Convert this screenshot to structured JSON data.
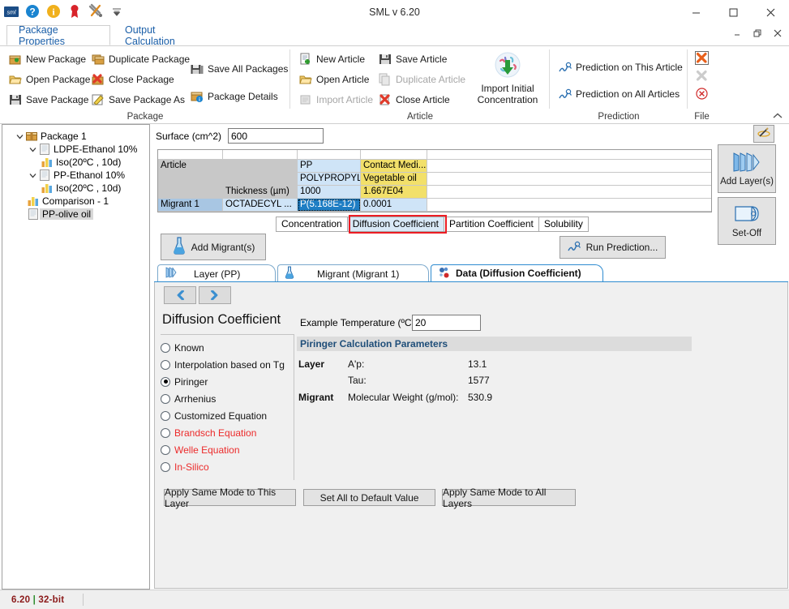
{
  "window": {
    "title": "SML v 6.20",
    "minimize": "—",
    "maximize": "☐",
    "close": "✕",
    "sub_minimize": "–",
    "sub_restore": "❐",
    "sub_close": "✕"
  },
  "quick_access": {
    "icons": [
      "sml-logo-icon",
      "help-icon",
      "info-icon",
      "award-icon",
      "tools-icon",
      "customize-qat-icon"
    ]
  },
  "ribbon_tabs": [
    {
      "label": "Package Properties",
      "active": true
    },
    {
      "label": "Output Calculation",
      "active": false
    }
  ],
  "ribbon": {
    "collapse_label": "˄",
    "groups": [
      {
        "name": "Package",
        "label": "Package",
        "items": [
          {
            "label": "New Package",
            "icon": "new-package-icon",
            "disabled": false
          },
          {
            "label": "Open Package",
            "icon": "open-package-icon",
            "disabled": false
          },
          {
            "label": "Save Package",
            "icon": "save-package-icon",
            "disabled": false
          },
          {
            "label": "Duplicate Package",
            "icon": "duplicate-package-icon",
            "disabled": false
          },
          {
            "label": "Close Package",
            "icon": "close-package-icon",
            "disabled": false
          },
          {
            "label": "Save Package As",
            "icon": "save-package-as-icon",
            "disabled": false
          },
          {
            "label": "Save All Packages",
            "icon": "save-all-packages-icon",
            "disabled": false
          },
          {
            "label": "Package Details",
            "icon": "package-details-icon",
            "disabled": false
          }
        ]
      },
      {
        "name": "Article",
        "label": "Article",
        "items": [
          {
            "label": "New Article",
            "icon": "new-article-icon",
            "disabled": false
          },
          {
            "label": "Open Article",
            "icon": "open-article-icon",
            "disabled": false
          },
          {
            "label": "Import Article",
            "icon": "import-article-icon",
            "disabled": true
          },
          {
            "label": "Save Article",
            "icon": "save-article-icon",
            "disabled": false
          },
          {
            "label": "Duplicate Article",
            "icon": "duplicate-article-icon",
            "disabled": true
          },
          {
            "label": "Close Article",
            "icon": "close-article-icon",
            "disabled": false
          },
          {
            "label": "Import Initial Concentration",
            "icon": "import-initial-concentration-icon",
            "disabled": false
          }
        ]
      },
      {
        "name": "Prediction",
        "label": "Prediction",
        "items": [
          {
            "label": "Prediction on This Article",
            "icon": "prediction-icon",
            "disabled": false
          },
          {
            "label": "Prediction on All Articles",
            "icon": "prediction-icon",
            "disabled": false
          }
        ]
      },
      {
        "name": "File",
        "label": "File",
        "items": [
          {
            "label": "",
            "icon": "close-red-x-icon",
            "disabled": false
          },
          {
            "label": "",
            "icon": "close-grey-x-icon",
            "disabled": true
          },
          {
            "label": "",
            "icon": "exit-circle-x-icon",
            "disabled": false
          }
        ]
      }
    ]
  },
  "tree": [
    {
      "depth": 0,
      "label": "Package 1",
      "icon": "package-icon",
      "expander": "expanded",
      "selected": false
    },
    {
      "depth": 1,
      "label": "LDPE-Ethanol 10%",
      "icon": "article-icon",
      "expander": "expanded",
      "selected": false
    },
    {
      "depth": 2,
      "label": "Iso(20ºC , 10d)",
      "icon": "chart-icon",
      "expander": "none",
      "selected": false
    },
    {
      "depth": 1,
      "label": "PP-Ethanol 10%",
      "icon": "article-icon",
      "expander": "expanded",
      "selected": false
    },
    {
      "depth": 2,
      "label": "Iso(20ºC , 10d)",
      "icon": "chart-icon",
      "expander": "none",
      "selected": false
    },
    {
      "depth": 1,
      "label": "Comparison - 1",
      "icon": "chart-icon",
      "expander": "none",
      "selected": false
    },
    {
      "depth": 1,
      "label": "PP-olive oil",
      "icon": "article-icon",
      "expander": "none",
      "selected": true
    }
  ],
  "surface": {
    "label": "Surface (cm^2)",
    "value": "600"
  },
  "article_grid": {
    "rows": [
      {
        "cells": [
          "",
          "",
          "",
          "",
          ""
        ],
        "styles": [
          "bg-white",
          "bg-white",
          "bg-white",
          "bg-white",
          "bg-white"
        ]
      },
      {
        "cells": [
          "Article",
          "",
          "PP",
          "Contact Medi...",
          ""
        ],
        "styles": [
          "bg-grey",
          "bg-grey",
          "bg-lblue",
          "bg-yellow",
          "bg-white"
        ]
      },
      {
        "cells": [
          "",
          "",
          "POLYPROPYL...",
          "Vegetable oil",
          ""
        ],
        "styles": [
          "bg-grey",
          "bg-grey",
          "bg-lblue",
          "bg-yellow",
          "bg-white"
        ]
      },
      {
        "cells": [
          "",
          "Thickness (µm)",
          "1000",
          "1.667E04",
          ""
        ],
        "styles": [
          "bg-grey",
          "bg-grey",
          "bg-lblue",
          "bg-yellow",
          "bg-white"
        ]
      },
      {
        "cells": [
          "Migrant 1",
          "OCTADECYL ...",
          "P(5.168E-12)",
          "0.0001",
          ""
        ],
        "styles": [
          "bg-blue",
          "bg-lblue",
          "bg-sel",
          "bg-lblue",
          "bg-white"
        ]
      }
    ]
  },
  "side_buttons": {
    "wand": {
      "label": "",
      "icon": "magic-wand-icon"
    },
    "add_layers": {
      "label": "Add Layer(s)",
      "icon": "layers-icon"
    },
    "set_off": {
      "label": "Set-Off",
      "icon": "set-off-icon"
    }
  },
  "property_tabs": [
    {
      "label": "Concentration",
      "highlighted": false
    },
    {
      "label": "Diffusion Coefficient",
      "highlighted": true
    },
    {
      "label": "Partition Coefficient",
      "highlighted": false
    },
    {
      "label": "Solubility",
      "highlighted": false
    }
  ],
  "actions": {
    "add_migrant": "Add Migrant(s)",
    "add_migrant_icon": "flask-icon",
    "run_prediction": "Run Prediction...",
    "run_prediction_icon": "prediction-icon"
  },
  "detail_tabs": [
    {
      "label": "Layer (PP)",
      "icon": "layers-icon",
      "active": false
    },
    {
      "label": "Migrant (Migrant 1)",
      "icon": "flask-icon",
      "active": false
    },
    {
      "label": "Data (Diffusion Coefficient)",
      "icon": "molecule-icon",
      "active": true
    }
  ],
  "panel": {
    "nav_prev": "‹",
    "nav_next": "›",
    "title": "Diffusion Coefficient",
    "example_temperature_label": "Example Temperature (ºC):",
    "example_temperature_value": "20",
    "modes": [
      {
        "label": "Known",
        "selected": false,
        "red": false
      },
      {
        "label": "Interpolation based on Tg",
        "selected": false,
        "red": false
      },
      {
        "label": "Piringer",
        "selected": true,
        "red": false
      },
      {
        "label": "Arrhenius",
        "selected": false,
        "red": false
      },
      {
        "label": "Customized Equation",
        "selected": false,
        "red": false
      },
      {
        "label": "Brandsch Equation",
        "selected": false,
        "red": true
      },
      {
        "label": "Welle Equation",
        "selected": false,
        "red": true
      },
      {
        "label": "In-Silico",
        "selected": false,
        "red": true
      }
    ],
    "parameters_header": "Piringer Calculation Parameters",
    "parameters": [
      {
        "group": "Layer",
        "name": "A'p:",
        "value": "13.1"
      },
      {
        "group": "",
        "name": "Tau:",
        "value": "1577"
      },
      {
        "group": "Migrant",
        "name": "Molecular Weight (g/mol):",
        "value": "530.9"
      }
    ],
    "buttons": [
      "Apply Same Mode to This Layer",
      "Set All to Default Value",
      "Apply Same Mode to All Layers"
    ]
  },
  "status": {
    "version": "6.20",
    "separator": "|",
    "architecture": "32-bit"
  }
}
